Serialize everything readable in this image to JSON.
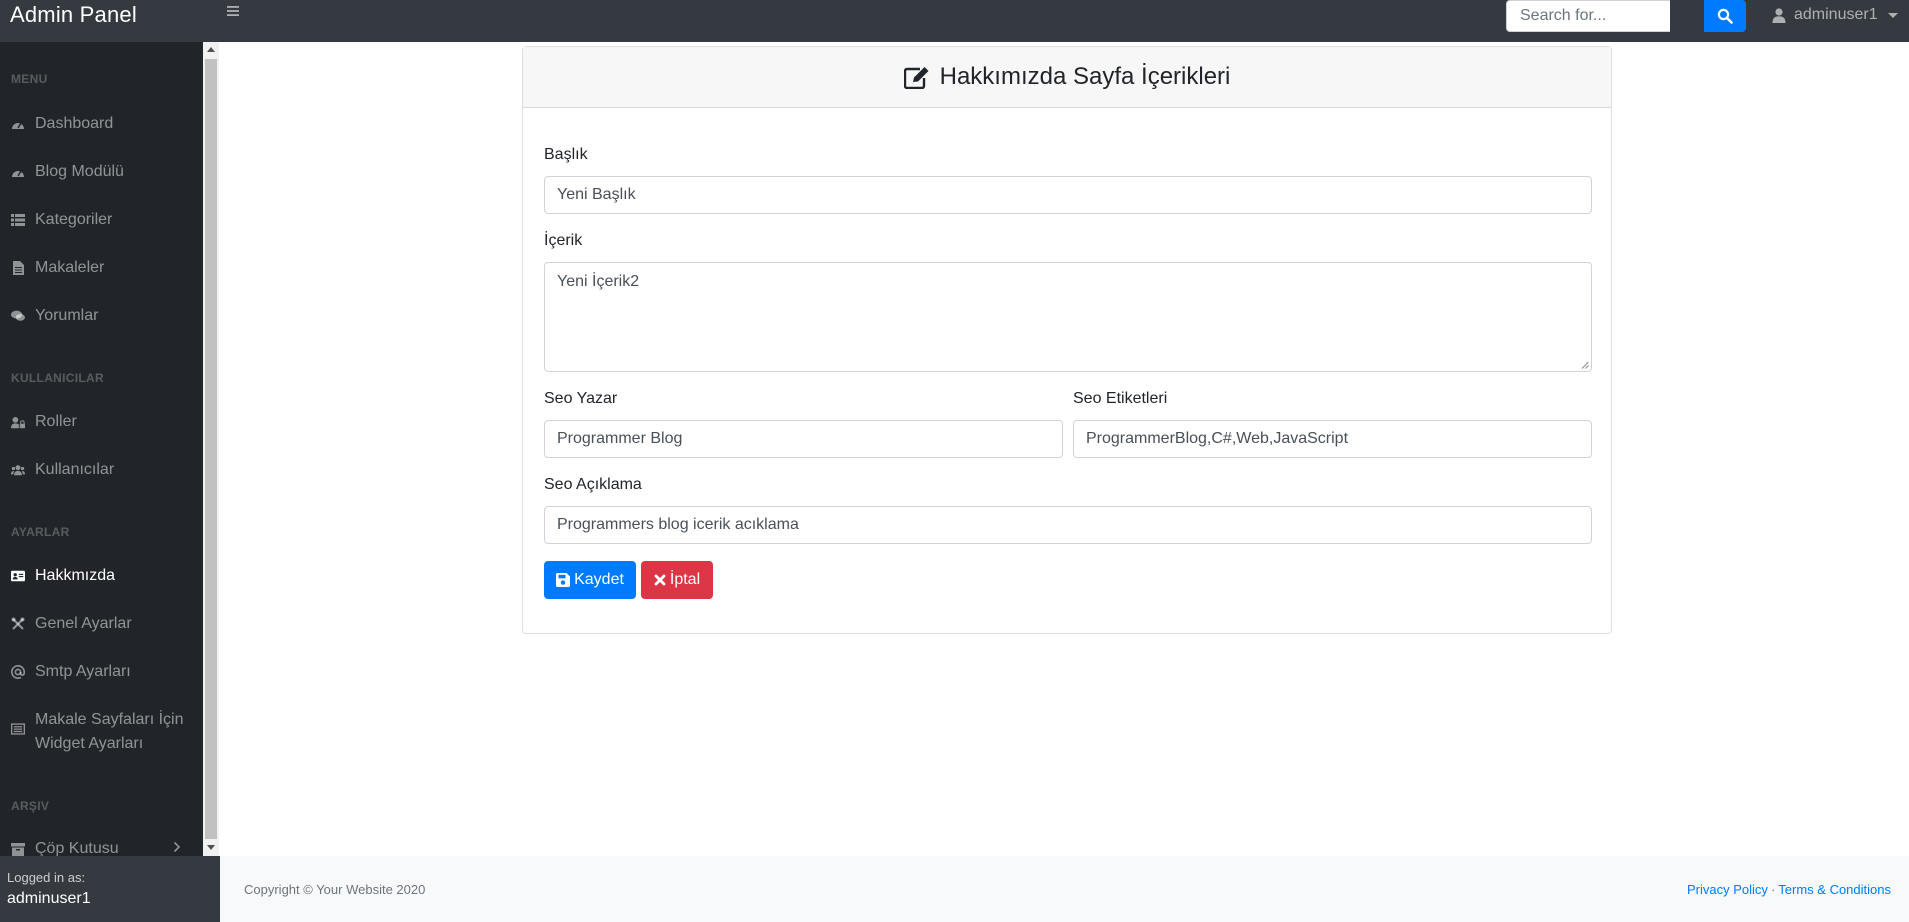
{
  "navbar": {
    "brand": "Admin Panel",
    "search_placeholder": "Search for...",
    "user": "adminuser1"
  },
  "sidebar": {
    "sections": [
      {
        "heading": "MENU",
        "items": [
          {
            "label": "Dashboard",
            "icon": "tachometer-icon"
          },
          {
            "label": "Blog Modülü",
            "icon": "tachometer-icon"
          },
          {
            "label": "Kategoriler",
            "icon": "list-icon"
          },
          {
            "label": "Makaleler",
            "icon": "file-icon"
          },
          {
            "label": "Yorumlar",
            "icon": "comments-icon"
          }
        ]
      },
      {
        "heading": "KULLANICILAR",
        "items": [
          {
            "label": "Roller",
            "icon": "user-lock-icon"
          },
          {
            "label": "Kullanıcılar",
            "icon": "users-icon"
          }
        ]
      },
      {
        "heading": "AYARLAR",
        "items": [
          {
            "label": "Hakkmızda",
            "icon": "id-card-icon",
            "active": true
          },
          {
            "label": "Genel Ayarlar",
            "icon": "tools-icon"
          },
          {
            "label": "Smtp Ayarları",
            "icon": "at-icon"
          },
          {
            "label": "Makale Sayfaları İçin Widget Ayarları",
            "line1": "Makale Sayfaları İçin",
            "line2": "Widget Ayarları",
            "icon": "newspaper-icon"
          }
        ]
      },
      {
        "heading": "ARŞIV",
        "items": [
          {
            "label": "Çöp Kutusu",
            "icon": "archive-icon"
          }
        ]
      }
    ],
    "footer": {
      "logged_in_label": "Logged in as:",
      "username": "adminuser1"
    }
  },
  "card": {
    "title": "Hakkımızda Sayfa İçerikleri",
    "fields": {
      "baslik": {
        "label": "Başlık",
        "value": "Yeni Başlık"
      },
      "icerik": {
        "label": "İçerik",
        "value": "Yeni İçerik2"
      },
      "seo_yazar": {
        "label": "Seo Yazar",
        "value": "Programmer Blog"
      },
      "seo_etiketleri": {
        "label": "Seo Etiketleri",
        "value": "ProgrammerBlog,C#,Web,JavaScript"
      },
      "seo_aciklama": {
        "label": "Seo Açıklama",
        "value": "Programmers blog icerik acıklama"
      }
    },
    "buttons": {
      "save": "Kaydet",
      "cancel": "İptal"
    }
  },
  "footer": {
    "copyright": "Copyright © Your Website 2020",
    "privacy": "Privacy Policy",
    "separator": "·",
    "terms": "Terms & Conditions"
  },
  "colors": {
    "primary": "#007bff",
    "danger": "#dc3545",
    "navbar": "#343a40",
    "sidebar": "#212529"
  }
}
